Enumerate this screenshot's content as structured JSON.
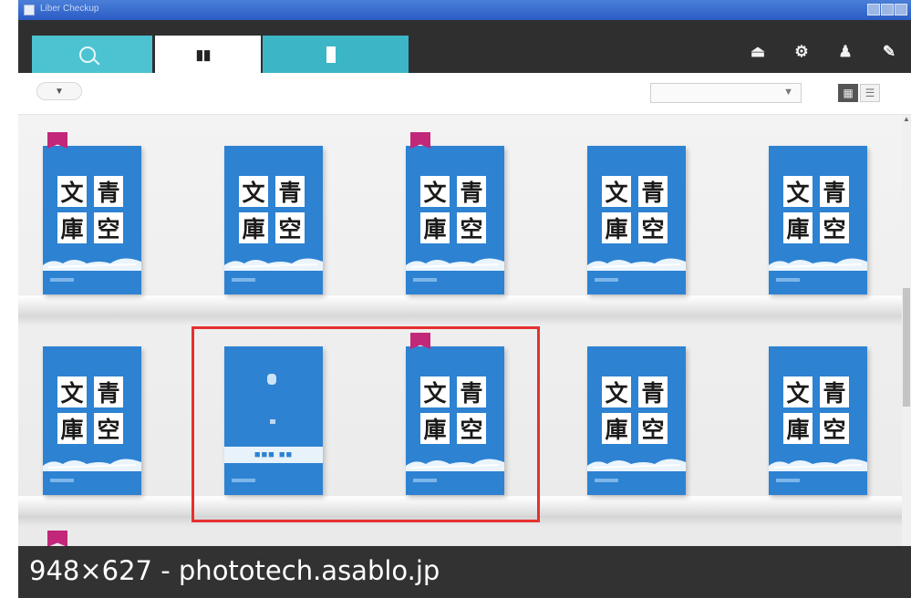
{
  "window": {
    "title": "Liber Checkup",
    "app_icon": "app-icon",
    "controls": [
      "minimize-icon",
      "maximize-icon",
      "close-icon"
    ]
  },
  "tabs": [
    {
      "label": "",
      "icon": "search-icon"
    },
    {
      "label": "",
      "icon": "books-icon"
    },
    {
      "label": "",
      "icon": "book-icon"
    }
  ],
  "toolbar": {
    "icons": [
      "eject-icon",
      "gear-icon",
      "user-icon",
      "wrench-icon"
    ],
    "glyphs": [
      "⏏",
      "⚙",
      "♟",
      "✎"
    ]
  },
  "filter": {
    "pill_label": "▼",
    "sort_value": "▼",
    "view_grid": "▦",
    "view_list": "☰"
  },
  "covers": {
    "kanji": [
      "文",
      "青",
      "庫",
      "空"
    ]
  },
  "books": {
    "row1": [
      {
        "ribbon": true
      },
      {
        "ribbon": false
      },
      {
        "ribbon": true
      },
      {
        "ribbon": false
      },
      {
        "ribbon": false
      }
    ],
    "row2": [
      {
        "ribbon": false,
        "plain": false
      },
      {
        "ribbon": false,
        "plain": true
      },
      {
        "ribbon": true,
        "plain": false
      },
      {
        "ribbon": false,
        "plain": false
      },
      {
        "ribbon": false,
        "plain": false
      }
    ]
  },
  "colors": {
    "accent_tab": "#4dc3d1",
    "cover_blue": "#2d82d2",
    "ribbon": "#c2277a",
    "highlight": "#e53030"
  },
  "caption": {
    "text": "948×627 - phototech.asablo.jp"
  }
}
